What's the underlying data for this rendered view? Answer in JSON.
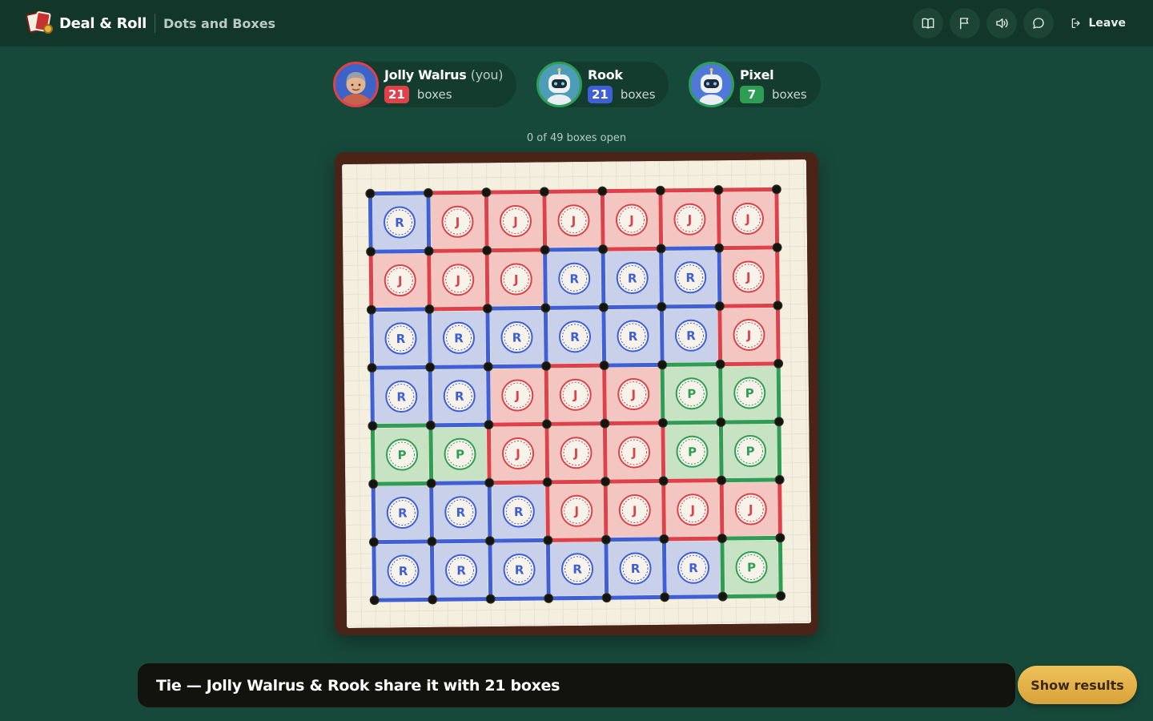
{
  "header": {
    "brand": "Deal & Roll",
    "game": "Dots and Boxes",
    "leave_label": "Leave"
  },
  "tools": [
    {
      "name": "rules-book-icon"
    },
    {
      "name": "flag-icon"
    },
    {
      "name": "sound-icon"
    },
    {
      "name": "chat-icon"
    }
  ],
  "players": [
    {
      "name": "Jolly Walrus",
      "suffix": "(you)",
      "score": "21",
      "unit": "boxes",
      "color": "#e0404a"
    },
    {
      "name": "Rook",
      "suffix": "",
      "score": "21",
      "unit": "boxes",
      "color": "#3e5fd6"
    },
    {
      "name": "Pixel",
      "suffix": "",
      "score": "7",
      "unit": "boxes",
      "color": "#2f9e55"
    }
  ],
  "status": "0 of 49 boxes open",
  "board": {
    "size": 7,
    "owners": [
      "RJJJJJJ",
      "JJJRRRJ",
      "RRRRRRJ",
      "RRJJJPP",
      "PPJJJPP",
      "RRRJJJJ",
      "RRRRRRP"
    ],
    "box_labels": {
      "J": "J",
      "R": "R",
      "P": "P"
    },
    "colors": {
      "J": {
        "line": "#e0404a",
        "fill": "#f3c6c2",
        "ink": "#d9434a"
      },
      "R": {
        "line": "#3e5fd6",
        "fill": "#c9d0ea",
        "ink": "#3e5fd6"
      },
      "P": {
        "line": "#2f9e55",
        "fill": "#c8e2c4",
        "ink": "#2f9e55"
      }
    }
  },
  "result": {
    "message": "Tie — Jolly Walrus & Rook share it with 21 boxes",
    "button": "Show results"
  }
}
